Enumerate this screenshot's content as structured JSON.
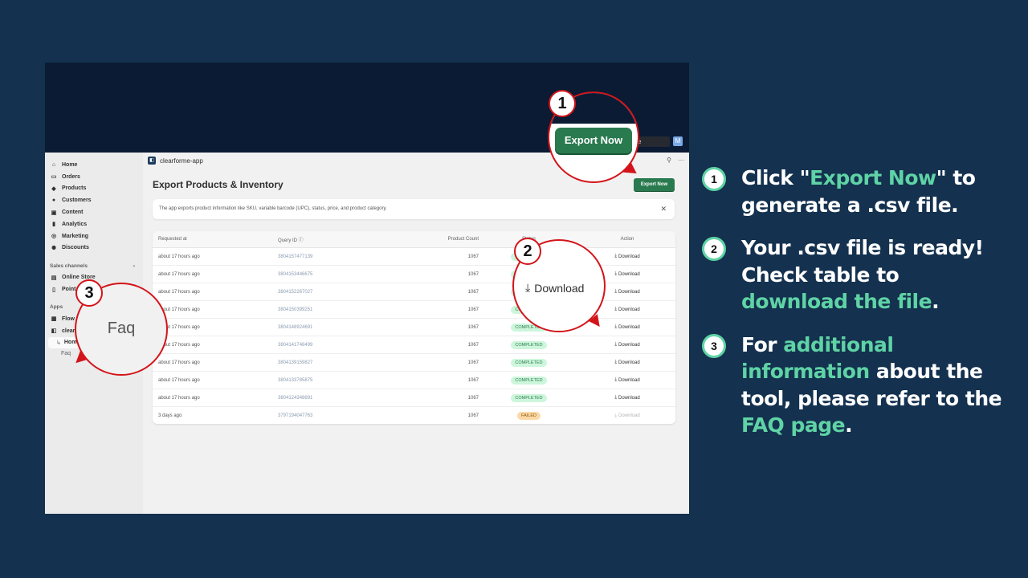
{
  "app": {
    "name": "clearforme-app",
    "page_title": "Export Products & Inventory",
    "export_button": "Export Now",
    "banner_text": "The app exports product information like SKU, variable barcode (UPC), status, price, and product category.",
    "search_stub": "e",
    "avatar_stub": "M"
  },
  "sidebar": {
    "items": [
      {
        "label": "Home",
        "icon": "home-icon"
      },
      {
        "label": "Orders",
        "icon": "inbox-icon"
      },
      {
        "label": "Products",
        "icon": "tag-icon"
      },
      {
        "label": "Customers",
        "icon": "person-icon"
      },
      {
        "label": "Content",
        "icon": "image-icon"
      },
      {
        "label": "Analytics",
        "icon": "bar-chart-icon"
      },
      {
        "label": "Marketing",
        "icon": "target-icon"
      },
      {
        "label": "Discounts",
        "icon": "discount-icon"
      }
    ],
    "sales_channels_label": "Sales channels",
    "sales_channels": [
      {
        "label": "Online Store",
        "icon": "store-icon"
      },
      {
        "label": "Point of Sale",
        "icon": "pos-icon"
      }
    ],
    "apps_label": "Apps",
    "apps": [
      {
        "label": "Flow",
        "icon": "flow-icon"
      },
      {
        "label": "clearforme-app",
        "icon": "app-icon"
      }
    ],
    "app_subitems": [
      "Home",
      "Faq"
    ]
  },
  "table": {
    "headers": [
      "Requested at",
      "Query ID",
      "Product Count",
      "Status",
      "Action"
    ],
    "rows": [
      {
        "requested": "about 17 hours ago",
        "query_id": "3804157477139",
        "count": "1067",
        "status": "COMPLETED",
        "action": "Download"
      },
      {
        "requested": "about 17 hours ago",
        "query_id": "3804153446675",
        "count": "1067",
        "status": "COMPLETED",
        "action": "Download"
      },
      {
        "requested": "about 17 hours ago",
        "query_id": "3804152267027",
        "count": "1067",
        "status": "COMPLETED",
        "action": "Download"
      },
      {
        "requested": "about 17 hours ago",
        "query_id": "3804150399251",
        "count": "1067",
        "status": "COMPLETED",
        "action": "Download"
      },
      {
        "requested": "about 17 hours ago",
        "query_id": "3804148924691",
        "count": "1067",
        "status": "COMPLETED",
        "action": "Download"
      },
      {
        "requested": "about 17 hours ago",
        "query_id": "3804141748499",
        "count": "1067",
        "status": "COMPLETED",
        "action": "Download"
      },
      {
        "requested": "about 17 hours ago",
        "query_id": "3804139159827",
        "count": "1067",
        "status": "COMPLETED",
        "action": "Download"
      },
      {
        "requested": "about 17 hours ago",
        "query_id": "3804133785875",
        "count": "1067",
        "status": "COMPLETED",
        "action": "Download"
      },
      {
        "requested": "about 17 hours ago",
        "query_id": "3804124348691",
        "count": "1067",
        "status": "COMPLETED",
        "action": "Download"
      },
      {
        "requested": "3 days ago",
        "query_id": "3797194047763",
        "count": "1067",
        "status": "FAILED",
        "action": "Download"
      }
    ]
  },
  "callouts": {
    "one": {
      "num": "1",
      "label": "Export Now"
    },
    "two": {
      "num": "2",
      "label": "Download"
    },
    "three": {
      "num": "3",
      "label": "Faq"
    }
  },
  "steps": [
    {
      "num": "1",
      "parts": [
        {
          "t": "Click \"",
          "hl": false
        },
        {
          "t": "Export Now",
          "hl": true
        },
        {
          "t": "\" to generate a .csv file.",
          "hl": false
        }
      ]
    },
    {
      "num": "2",
      "parts": [
        {
          "t": "Your .csv file is ready! Check table to ",
          "hl": false
        },
        {
          "t": "download the file",
          "hl": true
        },
        {
          "t": ".",
          "hl": false
        }
      ]
    },
    {
      "num": "3",
      "parts": [
        {
          "t": "For ",
          "hl": false
        },
        {
          "t": "additional information",
          "hl": true
        },
        {
          "t": " about the tool, please refer to the ",
          "hl": false
        },
        {
          "t": "FAQ page",
          "hl": true
        },
        {
          "t": ".",
          "hl": false
        }
      ]
    }
  ],
  "colors": {
    "background": "#14314f",
    "accent": "#5fd3a5",
    "callout_red": "#d3141a",
    "export_green": "#2a7a4f"
  }
}
